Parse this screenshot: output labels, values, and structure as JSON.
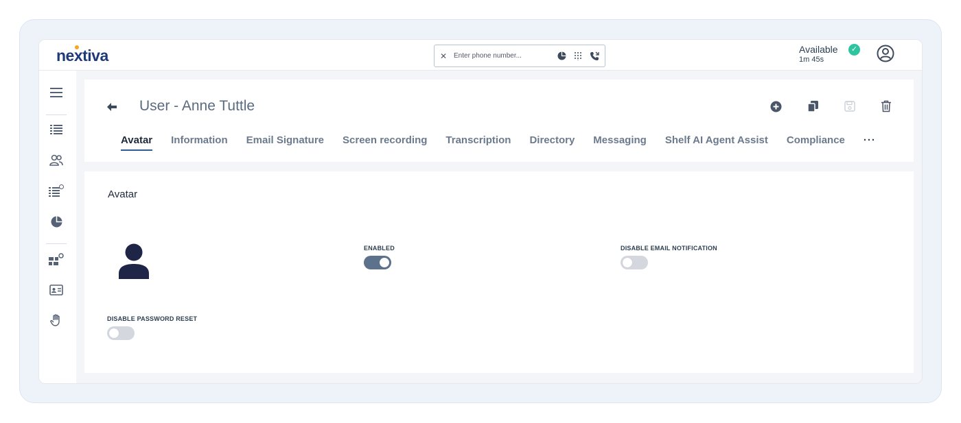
{
  "app": {
    "logo": "nextiva"
  },
  "topbar": {
    "phone_placeholder": "Enter phone number...",
    "status_label": "Available",
    "status_time": "1m 45s"
  },
  "sidebar": {
    "items": [
      "menu-icon",
      "list-icon",
      "users-icon",
      "queue-list-icon",
      "pie-chart-icon",
      "dashboard-icon",
      "id-card-icon",
      "hand-icon"
    ]
  },
  "header": {
    "title": "User - Anne Tuttle",
    "actions": [
      "add-icon",
      "copy-icon",
      "save-icon",
      "delete-icon"
    ]
  },
  "tabs": [
    {
      "label": "Avatar",
      "active": true
    },
    {
      "label": "Information"
    },
    {
      "label": "Email Signature"
    },
    {
      "label": "Screen recording"
    },
    {
      "label": "Transcription"
    },
    {
      "label": "Directory"
    },
    {
      "label": "Messaging"
    },
    {
      "label": "Shelf AI Agent Assist"
    },
    {
      "label": "Compliance"
    },
    {
      "label": "···"
    }
  ],
  "avatar_section": {
    "title": "Avatar",
    "enabled_label": "ENABLED",
    "enabled_value": true,
    "disable_email_label": "DISABLE EMAIL NOTIFICATION",
    "disable_email_value": false,
    "disable_password_label": "DISABLE PASSWORD RESET",
    "disable_password_value": false
  },
  "colors": {
    "accent": "#2c5c96",
    "available": "#2ec4a0",
    "brand_dot": "#f5a623"
  }
}
